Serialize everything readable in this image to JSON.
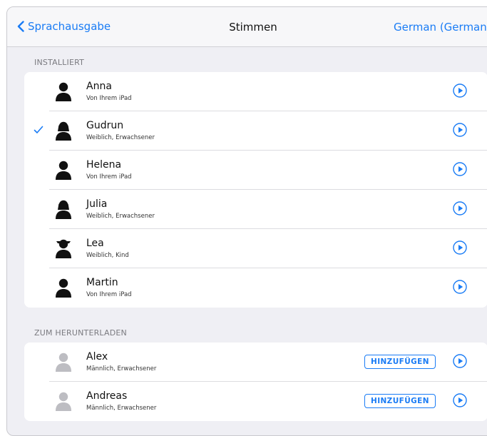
{
  "nav": {
    "back_label": "Sprachausgabe",
    "title": "Stimmen",
    "right_label": "German (Germany)"
  },
  "installed": {
    "header": "INSTALLIERT",
    "items": [
      {
        "name": "Anna",
        "sub": "Von Ihrem iPad",
        "checked": false,
        "avatar": "person-icon"
      },
      {
        "name": "Gudrun",
        "sub": "Weiblich, Erwachsener",
        "checked": true,
        "avatar": "person-female-icon"
      },
      {
        "name": "Helena",
        "sub": "Von Ihrem iPad",
        "checked": false,
        "avatar": "person-icon"
      },
      {
        "name": "Julia",
        "sub": "Weiblich, Erwachsener",
        "checked": false,
        "avatar": "person-female-icon"
      },
      {
        "name": "Lea",
        "sub": "Weiblich, Kind",
        "checked": false,
        "avatar": "person-child-icon"
      },
      {
        "name": "Martin",
        "sub": "Von Ihrem iPad",
        "checked": false,
        "avatar": "person-icon"
      }
    ]
  },
  "download": {
    "header": "ZUM HERUNTERLADEN",
    "add_label": "HINZUFÜGEN",
    "items": [
      {
        "name": "Alex",
        "sub": "Männlich, Erwachsener",
        "avatar": "person-icon"
      },
      {
        "name": "Andreas",
        "sub": "Männlich, Erwachsener",
        "avatar": "person-icon"
      }
    ]
  },
  "colors": {
    "accent": "#1a7cf5",
    "avatar_installed": "#111111",
    "avatar_download": "#bdbdc2"
  }
}
